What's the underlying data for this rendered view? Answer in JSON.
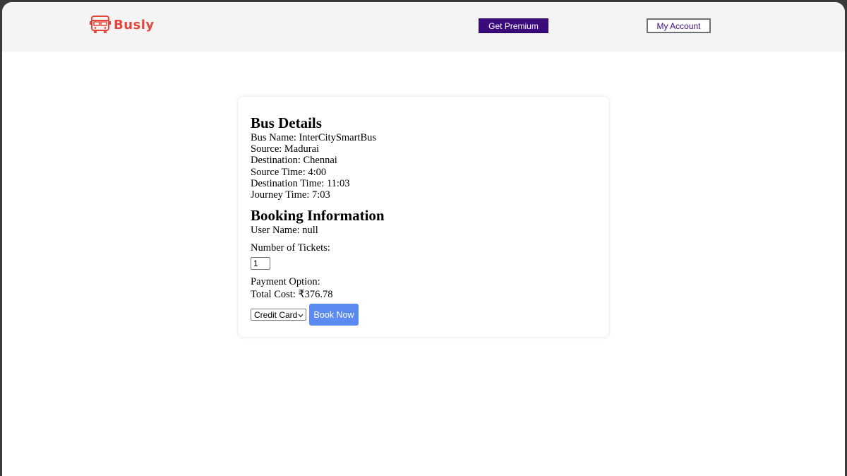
{
  "brand": {
    "name": "Busly",
    "accent_color": "#e5443a",
    "icon": "bus-icon"
  },
  "nav": {
    "premium_label": "Get Premium",
    "account_label": "My Account"
  },
  "bus_details": {
    "heading": "Bus Details",
    "lines": [
      "Bus Name: InterCitySmartBus",
      "Source: Madurai",
      "Destination: Chennai",
      "Source Time: 4:00",
      "Destination Time: 11:03",
      "Journey Time: 7:03"
    ]
  },
  "booking": {
    "heading": "Booking Information",
    "user_line": "User Name: null",
    "tickets_label": "Number of Tickets:",
    "tickets_value": "1",
    "payment_label": "Payment Option:",
    "total_cost_line": "Total Cost: ₹376.78",
    "payment_selected": "Credit Card",
    "book_label": "Book Now",
    "book_color": "#5b8bf0"
  }
}
